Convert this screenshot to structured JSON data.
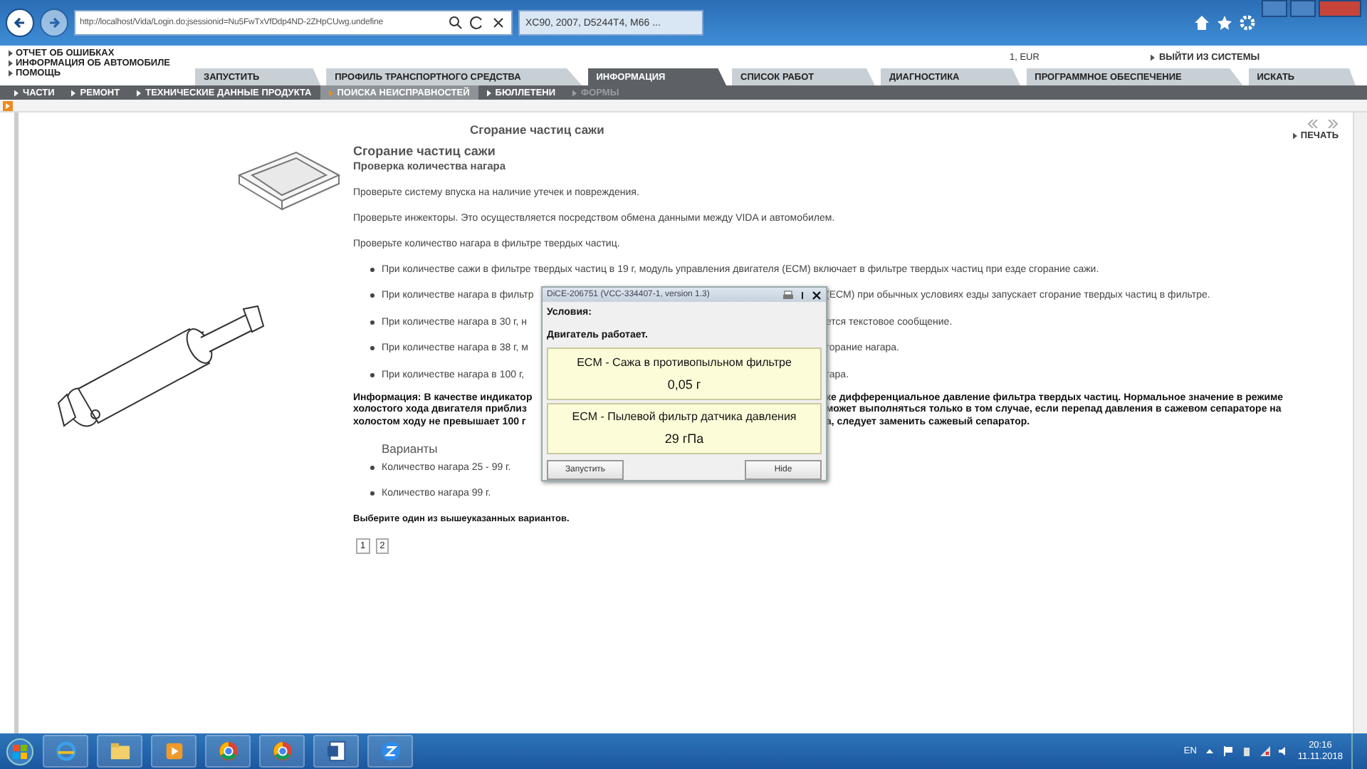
{
  "browser": {
    "address": "http://localhost/Vida/Login.do;jsessionid=Nu5FwTxVfDdp4ND-2ZHpCUwg.undefine",
    "tab": "XC90, 2007, D5244T4, M66 ..."
  },
  "header": {
    "links": [
      "ОТЧЕТ ОБ ОШИБКАХ",
      "ИНФОРМАЦИЯ ОБ АВТОМОБИЛЕ",
      "ПОМОЩЬ"
    ],
    "account": "1, EUR",
    "logout": "ВЫЙТИ ИЗ СИСТЕМЫ"
  },
  "tabs": [
    {
      "label": "ЗАПУСТИТЬ",
      "selected": false
    },
    {
      "label": "ПРОФИЛЬ ТРАНСПОРТНОГО СРЕДСТВА",
      "selected": false
    },
    {
      "label": "ИНФОРМАЦИЯ",
      "selected": true
    },
    {
      "label": "СПИСОК РАБОТ",
      "selected": false
    },
    {
      "label": "ДИАГНОСТИКА",
      "selected": false
    },
    {
      "label": "ПРОГРАММНОЕ ОБЕСПЕЧЕНИЕ",
      "selected": false
    },
    {
      "label": "ИСКАТЬ",
      "selected": false
    }
  ],
  "subnav": [
    {
      "label": "ЧАСТИ",
      "selected": false,
      "disabled": false
    },
    {
      "label": "РЕМОНТ",
      "selected": false,
      "disabled": false
    },
    {
      "label": "ТЕХНИЧЕСКИЕ ДАННЫЕ ПРОДУКТА",
      "selected": false,
      "disabled": false
    },
    {
      "label": "ПОИСКА НЕИСПРАВНОСТЕЙ",
      "selected": true,
      "disabled": false
    },
    {
      "label": "БЮЛЛЕТЕНИ",
      "selected": false,
      "disabled": false
    },
    {
      "label": "ФОРМЫ",
      "selected": false,
      "disabled": true
    }
  ],
  "page": {
    "heading": "Сгорание частиц сажи",
    "print": "ПЕЧАТЬ",
    "title": "Сгорание частиц сажи",
    "subtitle": "Проверка количества нагара",
    "paragraphs": [
      "Проверьте систему впуска на наличие утечек и повреждения.",
      "Проверьте инжекторы. Это осуществляется посредством обмена данными между VIDA и автомобилем.",
      "Проверьте количество нагара в фильтре твердых частиц."
    ],
    "bullets": [
      {
        "kind": "full",
        "text": "При количестве сажи в фильтре твердых частиц в 19 г, модуль управления двигателя (ECM) включает в фильтре твердых частиц при езде сгорание сажи."
      },
      {
        "kind": "split",
        "left": "При количестве нагара в фильтр",
        "right": "(ECM) при обычных условиях езды запускает сгорание твердых частиц в фильтре."
      },
      {
        "kind": "split",
        "left": "При количестве нагара в 30 г, н",
        "right": "ется текстовое сообщение."
      },
      {
        "kind": "split",
        "left": "При количестве нагара в 38 г, м",
        "right": "горание нагара."
      },
      {
        "kind": "split",
        "left": "При количестве нагара в 100 г,",
        "right": "гара."
      }
    ],
    "info_lines": [
      {
        "left": "Информация: В качестве индикатор",
        "right": "ке дифференциальное давление фильтра твердых частиц. Нормальное значение в режиме"
      },
      {
        "left": "холостого хода двигателя приблиз",
        "right": "может выполняться только в том случае, если перепад давления в сажевом сепараторе на"
      },
      {
        "left": "холостом ходу не превышает 100 г",
        "right": "а, следует заменить сажевый сепаратор."
      }
    ],
    "variants_title": "Варианты",
    "variants": [
      "Количество нагара 25 - 99 г.",
      "Количество нагара 99 г."
    ],
    "prompt": "Выберите один из вышеуказанных вариантов.",
    "pages": [
      "1",
      "2"
    ]
  },
  "dialog": {
    "title": "DiCE-206751  (VCC-334407-1, version 1.3)",
    "conditions_label": "Условия:",
    "condition": "Двигатель работает.",
    "readings": [
      {
        "name": "ECM - Сажа в противопыльном фильтре",
        "value": "0,05 г"
      },
      {
        "name": "ECM - Пылевой фильтр датчика давления",
        "value": "29 гПа"
      }
    ],
    "buttons": [
      "Запустить",
      "Hide"
    ]
  },
  "taskbar": {
    "lang": "EN",
    "time": "20:16",
    "date": "11.11.2018"
  }
}
